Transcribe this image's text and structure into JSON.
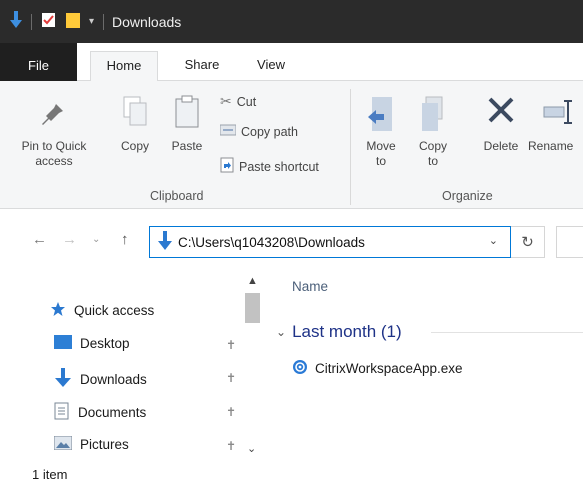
{
  "window": {
    "title": "Downloads"
  },
  "tabs": {
    "file": "File",
    "home": "Home",
    "share": "Share",
    "view": "View"
  },
  "ribbon": {
    "pin_label": "Pin to Quick access",
    "copy_label": "Copy",
    "paste_label": "Paste",
    "cut_label": "Cut",
    "copy_path_label": "Copy path",
    "paste_shortcut_label": "Paste shortcut",
    "clipboard_group": "Clipboard",
    "move_to_label": "Move to",
    "copy_to_label": "Copy to",
    "delete_label": "Delete",
    "rename_label": "Rename",
    "organize_group": "Organize"
  },
  "address": {
    "path": "C:\\Users\\q1043208\\Downloads"
  },
  "navpane": {
    "items": [
      {
        "label": "Quick access",
        "icon": "star-icon",
        "pinned": false
      },
      {
        "label": "Desktop",
        "icon": "desktop-icon",
        "pinned": true
      },
      {
        "label": "Downloads",
        "icon": "download-arrow-icon",
        "pinned": true
      },
      {
        "label": "Documents",
        "icon": "documents-icon",
        "pinned": true
      },
      {
        "label": "Pictures",
        "icon": "pictures-icon",
        "pinned": true
      }
    ]
  },
  "content": {
    "column_name": "Name",
    "group_label": "Last month (1)",
    "files": [
      {
        "name": "CitrixWorkspaceApp.exe",
        "icon": "citrix-icon"
      }
    ]
  },
  "status": {
    "text": "1 item"
  },
  "colors": {
    "accent": "#0078d7",
    "titlebar": "#2b2b2b",
    "group_text": "#1e3287"
  }
}
